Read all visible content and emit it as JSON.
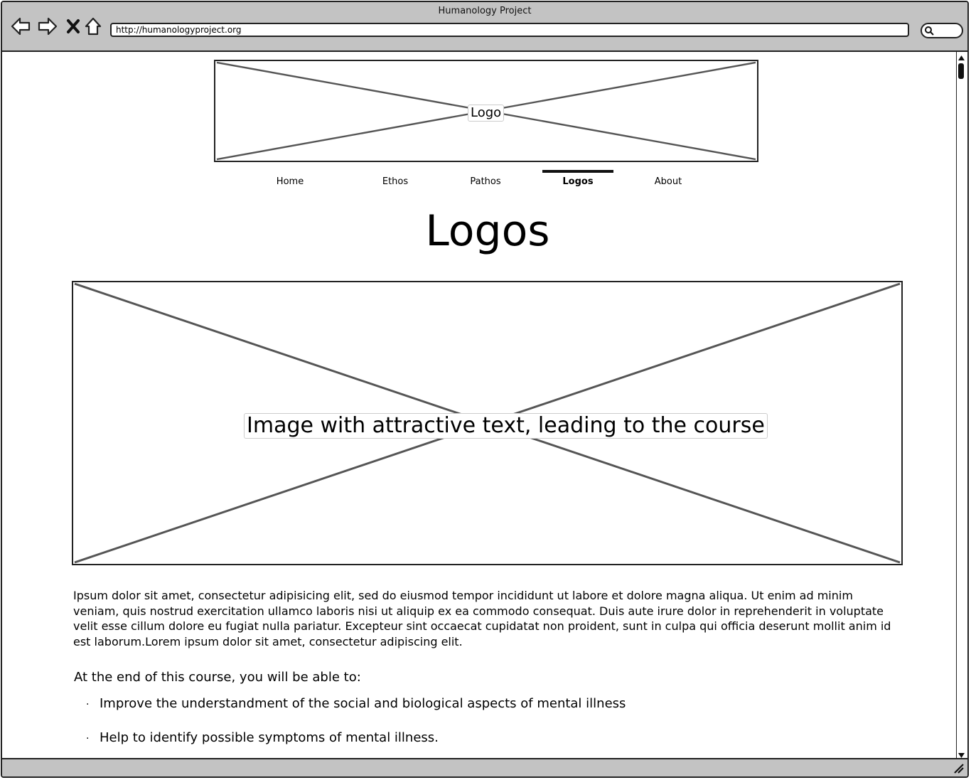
{
  "window": {
    "title": "Humanology Project",
    "url": "http://humanologyproject.org"
  },
  "toolbar": {
    "back_icon": "back-arrow-icon",
    "forward_icon": "forward-arrow-icon",
    "stop_icon": "close-icon",
    "home_icon": "home-icon",
    "search_icon": "search-icon"
  },
  "header": {
    "logo_label": "Logo"
  },
  "nav": {
    "items": [
      {
        "label": "Home",
        "active": false
      },
      {
        "label": "Ethos",
        "active": false
      },
      {
        "label": "Pathos",
        "active": false
      },
      {
        "label": "Logos",
        "active": true
      },
      {
        "label": "About",
        "active": false
      }
    ]
  },
  "main": {
    "title": "Logos",
    "hero_label": "Image with attractive text, leading to the course",
    "paragraph": "Ipsum dolor sit amet, consectetur adipisicing elit, sed do eiusmod tempor incididunt ut labore et dolore magna aliqua. Ut enim ad minim veniam, quis nostrud exercitation ullamco laboris nisi ut aliquip ex ea commodo consequat. Duis aute irure dolor in reprehenderit in voluptate velit esse cillum dolore eu fugiat nulla pariatur. Excepteur sint occaecat cupidatat non proident, sunt in culpa qui officia deserunt mollit anim id est laborum.Lorem ipsum dolor sit amet, consectetur adipiscing elit.",
    "course_intro": "At the end of this course, you will be able to:",
    "bullet_glyph": "·",
    "outcomes": [
      "Improve the understandment of the social and biological aspects of mental illness",
      "Help to identify possible symptoms of mental illness."
    ]
  }
}
